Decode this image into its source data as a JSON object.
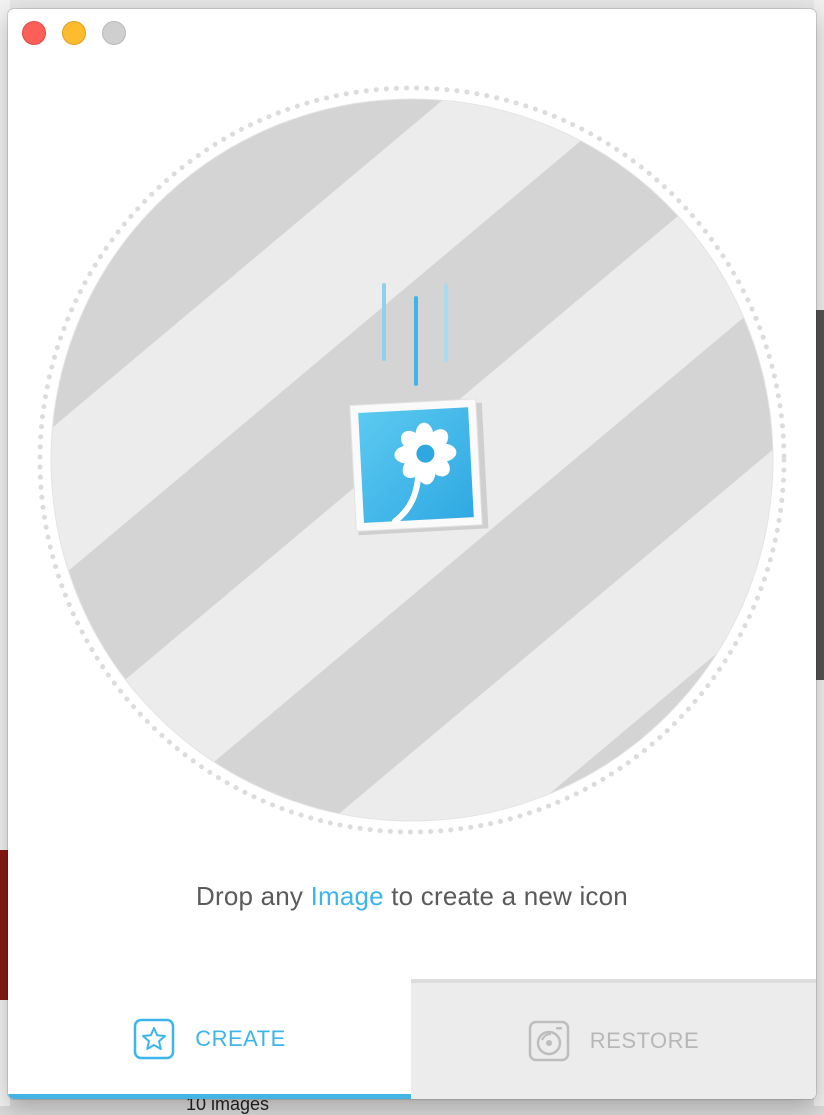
{
  "background": {
    "bottom_text": "10 images"
  },
  "window": {
    "controls": [
      "close",
      "minimize",
      "zoom"
    ]
  },
  "drop_zone": {
    "hint_prefix": "Drop any ",
    "hint_link": "Image",
    "hint_suffix": " to create a new icon",
    "icon": "flower-image-icon"
  },
  "tabs": [
    {
      "id": "create",
      "label": "CREATE",
      "icon": "star-icon",
      "active": true
    },
    {
      "id": "restore",
      "label": "RESTORE",
      "icon": "restore-disk-icon",
      "active": false
    }
  ],
  "colors": {
    "accent": "#3cb6ea",
    "stripe_light": "#ececec",
    "stripe_dark": "#d4d4d4",
    "inactive_text": "#b7b7b7",
    "close": "#fc5f57",
    "minimize": "#fdbc2e",
    "zoom": "#cfcfcf"
  }
}
